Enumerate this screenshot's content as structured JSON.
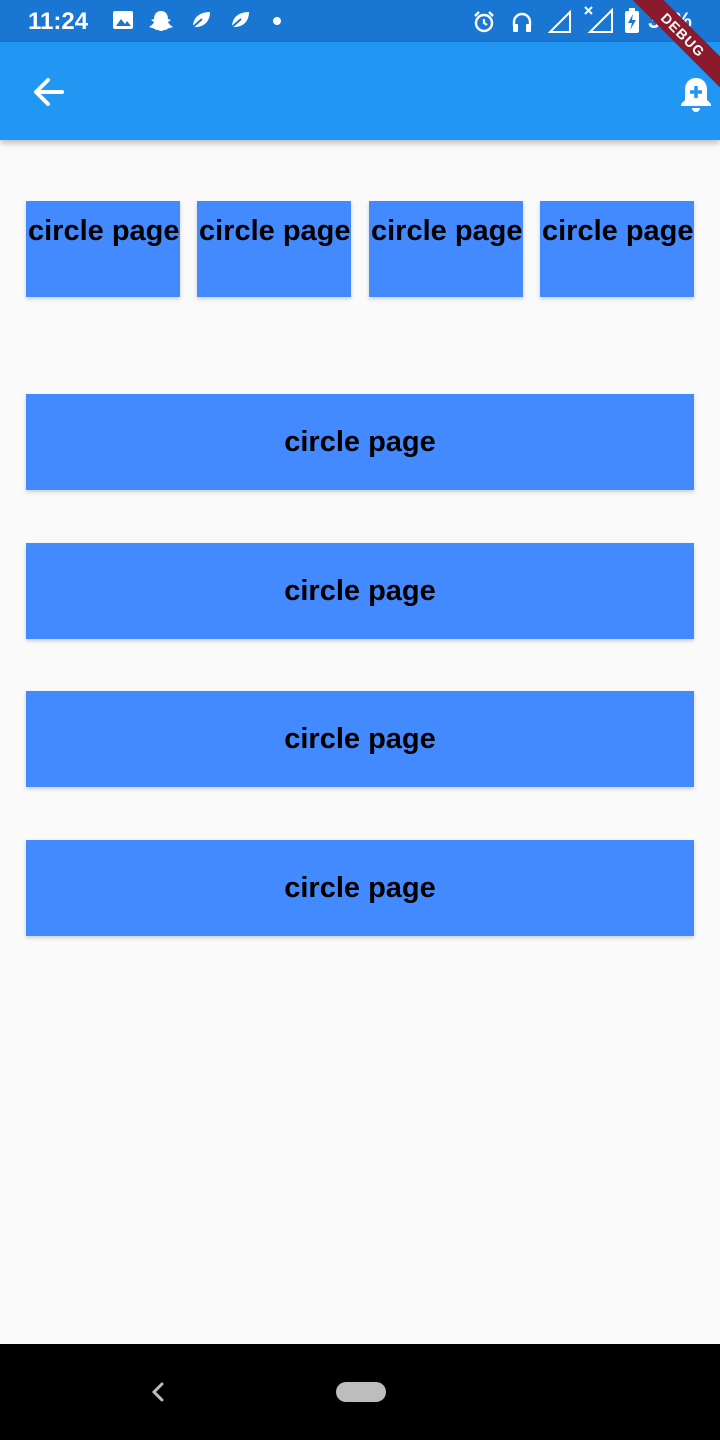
{
  "status_bar": {
    "time": "11:24",
    "battery": "35%",
    "left_icons": [
      "image-icon",
      "snapchat-icon",
      "leaf-icon",
      "leaf-icon",
      "dot-icon"
    ],
    "right_icons": [
      "alarm-icon",
      "headset-icon",
      "signal-icon",
      "signal-x-icon",
      "battery-charging-icon"
    ]
  },
  "debug_banner": "DEBUG",
  "app_bar": {
    "color": "#2196f3",
    "back_icon": "arrow-back-icon",
    "action_icon": "notification-add-icon"
  },
  "small_buttons": [
    {
      "label": "circle page"
    },
    {
      "label": "circle page"
    },
    {
      "label": "circle page"
    },
    {
      "label": "circle page"
    }
  ],
  "wide_buttons": [
    {
      "label": "circle page"
    },
    {
      "label": "circle page"
    },
    {
      "label": "circle page"
    },
    {
      "label": "circle page"
    }
  ],
  "button_color": "#448aff",
  "nav_bar": {
    "back_icon": "nav-back-icon",
    "home_icon": "home-pill-icon"
  }
}
